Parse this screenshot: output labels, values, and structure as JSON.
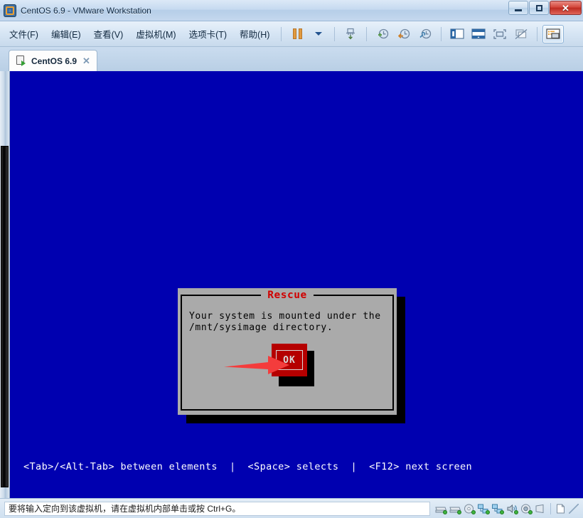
{
  "window": {
    "title": "CentOS 6.9 - VMware Workstation",
    "app_icon": "vmware-icon",
    "buttons": {
      "minimize": "minimize-button",
      "restore": "restore-button",
      "close_glyph": "✕"
    }
  },
  "menubar": {
    "items": [
      {
        "label": "文件(F)",
        "name": "menu-file"
      },
      {
        "label": "编辑(E)",
        "name": "menu-edit"
      },
      {
        "label": "查看(V)",
        "name": "menu-view"
      },
      {
        "label": "虚拟机(M)",
        "name": "menu-vm"
      },
      {
        "label": "选项卡(T)",
        "name": "menu-tabs"
      },
      {
        "label": "帮助(H)",
        "name": "menu-help"
      }
    ],
    "toolbar": [
      {
        "name": "pause-button",
        "icon": "pause-icon"
      },
      {
        "name": "power-dropdown-button",
        "icon": "chevron-down-icon"
      },
      {
        "name": "send-ctrl-alt-del-button",
        "icon": "send-key-icon"
      },
      {
        "name": "take-snapshot-button",
        "icon": "snapshot-add-icon"
      },
      {
        "name": "revert-snapshot-button",
        "icon": "snapshot-revert-icon"
      },
      {
        "name": "manage-snapshots-button",
        "icon": "snapshot-manage-icon"
      },
      {
        "name": "show-library-button",
        "icon": "sidebar-panel-icon"
      },
      {
        "name": "show-console-view-button",
        "icon": "console-view-icon"
      },
      {
        "name": "enter-fullscreen-button",
        "icon": "fullscreen-icon"
      },
      {
        "name": "unity-mode-button",
        "icon": "unity-mode-icon"
      },
      {
        "name": "show-thumbnail-bar-button",
        "icon": "thumbnail-bar-icon"
      }
    ]
  },
  "tabbar": {
    "tabs": [
      {
        "label": "CentOS 6.9",
        "icon": "vm-running-icon",
        "close_glyph": "✕",
        "active": true
      }
    ]
  },
  "vm_screen": {
    "background_color": "#0000b0",
    "dialog": {
      "title": "Rescue",
      "title_color": "#d00000",
      "body_color": "#aaaaaa",
      "text_line_1": "Your system is mounted under the",
      "text_line_2": "/mnt/sysimage directory.",
      "button": {
        "label": "OK",
        "color": "#b50000",
        "focused": true
      }
    },
    "annotation": {
      "type": "arrow",
      "color": "#f43c3c",
      "points_at": "ok-button"
    },
    "help_line": "<Tab>/<Alt-Tab> between elements  |  <Space> selects  |  <F12> next screen"
  },
  "statusbar": {
    "message": "要将输入定向到该虚拟机，请在虚拟机内部单击或按 Ctrl+G。",
    "devices": [
      {
        "name": "hard-disk-1-icon"
      },
      {
        "name": "hard-disk-2-icon"
      },
      {
        "name": "cd-dvd-icon"
      },
      {
        "name": "network-adapter-1-icon"
      },
      {
        "name": "network-adapter-2-icon"
      },
      {
        "name": "sound-card-icon"
      },
      {
        "name": "camera-icon"
      },
      {
        "name": "usb-device-icon"
      },
      {
        "name": "printer-icon"
      }
    ]
  }
}
